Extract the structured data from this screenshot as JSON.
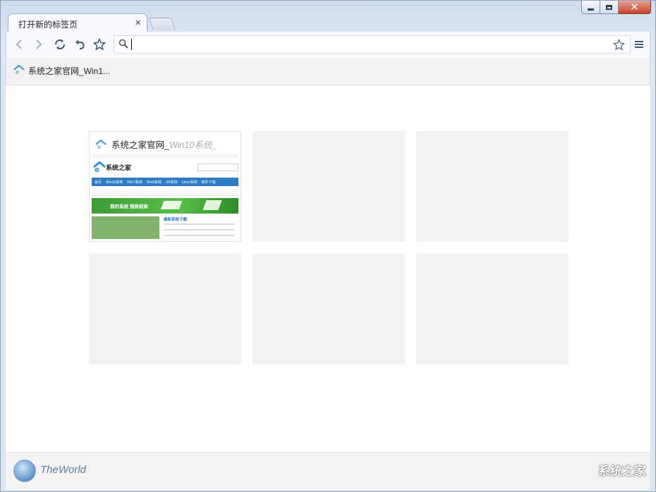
{
  "window": {
    "tab_title": "打开新的标签页",
    "tab_close": "×",
    "controls": {
      "minimize": "",
      "maximize": "",
      "close": "✕"
    }
  },
  "toolbar": {
    "icons": [
      "back-icon",
      "forward-icon",
      "refresh-icon",
      "undo-icon",
      "favorite-star-icon",
      "search-icon",
      "bookmark-star-icon",
      "menu-icon"
    ],
    "address_value": ""
  },
  "bookmarks": [
    {
      "label": "系统之家官网_Win1..."
    }
  ],
  "tiles": [
    {
      "title": "系统之家官网_Win10系统...",
      "title_main": "系统之家官网_",
      "title_faded": "Win10系统_",
      "has_thumbnail": true
    },
    {
      "title": "",
      "has_thumbnail": false
    },
    {
      "title": "",
      "has_thumbnail": false
    },
    {
      "title": "",
      "has_thumbnail": false
    },
    {
      "title": "",
      "has_thumbnail": false
    },
    {
      "title": "",
      "has_thumbnail": false
    }
  ],
  "thumbnail": {
    "logo_text": "系统之家",
    "nav_items": [
      "首页",
      "Win10系统",
      "Win7系统",
      "Win8系统",
      "XP系统",
      "Linux系统",
      "软件下载"
    ],
    "banner_text": "我的系统 想换就换",
    "list_title": "最新系统下载"
  },
  "footer": {
    "brand": "TheWorld",
    "watermark": "系统之家"
  },
  "colors": {
    "accent": "#2a7ab8",
    "thumb_green": "#4aa83a",
    "thumb_blue": "#2d7bc4"
  }
}
